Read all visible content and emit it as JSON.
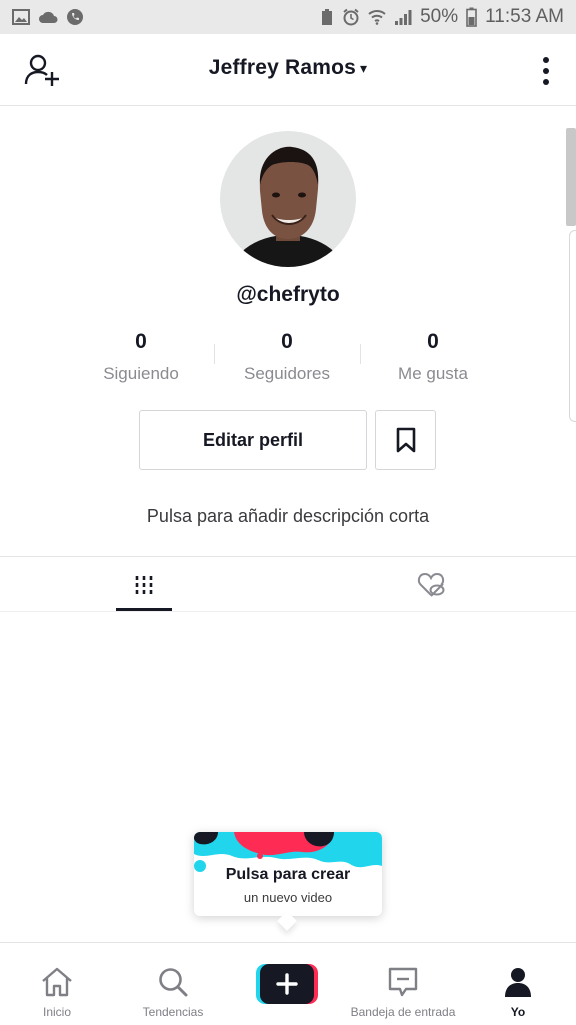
{
  "status_bar": {
    "battery": "50%",
    "time": "11:53 AM"
  },
  "header": {
    "title": "Jeffrey Ramos",
    "caret": "▾"
  },
  "profile": {
    "username": "@chefryto",
    "stats": [
      {
        "value": "0",
        "label": "Siguiendo"
      },
      {
        "value": "0",
        "label": "Seguidores"
      },
      {
        "value": "0",
        "label": "Me gusta"
      }
    ],
    "edit_button": "Editar perfil",
    "bio_placeholder": "Pulsa para añadir descripción corta"
  },
  "tabs": {
    "icons": [
      "videos-grid-icon",
      "liked-hidden-icon"
    ],
    "active": "videos"
  },
  "create_tooltip": {
    "title": "Pulsa para crear",
    "subtitle": "un nuevo video"
  },
  "bottom_nav": {
    "items": [
      {
        "label": "Inicio",
        "icon": "home-icon"
      },
      {
        "label": "Tendencias",
        "icon": "search-icon"
      },
      {
        "label": "Bandeja de entrada",
        "icon": "inbox-icon"
      },
      {
        "label": "Yo",
        "icon": "profile-icon"
      }
    ],
    "create_icon": "plus-icon"
  },
  "colors": {
    "text": "#161823",
    "secondary_text": "#8a8b91",
    "accent_cyan": "#20d5ec",
    "accent_red": "#fe2c55"
  }
}
